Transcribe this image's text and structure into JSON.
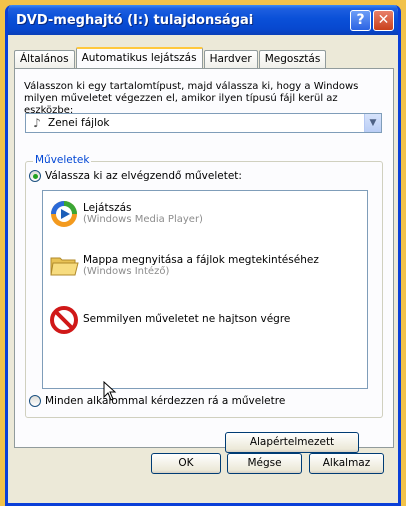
{
  "window": {
    "title": "DVD-meghajtó (I:) tulajdonságai",
    "help_label": "?",
    "close_label": "✕"
  },
  "tabs": [
    {
      "label": "Általános"
    },
    {
      "label": "Automatikus lejátszás"
    },
    {
      "label": "Hardver"
    },
    {
      "label": "Megosztás"
    }
  ],
  "active_tab": "Automatikus lejátszás",
  "content_type": {
    "description": "Válasszon ki egy tartalomtípust, majd válassza ki, hogy a Windows milyen műveletet végezzen el, amikor ilyen típusú fájl kerül az eszközbe:",
    "selected": "Zenei fájlok",
    "icon": "music-file-icon"
  },
  "actions_group": {
    "label": "Műveletek",
    "choose_label": "Válassza ki az elvégzendő műveletet:",
    "ask_label": "Minden alkalommal kérdezzen rá a műveletre",
    "selected_option": "choose",
    "items": [
      {
        "name": "Lejátszás",
        "sub": "(Windows Media Player)",
        "icon": "media-player-icon"
      },
      {
        "name": "Mappa megnyitása a fájlok megtekintéséhez",
        "sub": "(Windows Intéző)",
        "icon": "folder-icon"
      },
      {
        "name": "Semmilyen műveletet ne hajtson végre",
        "sub": "",
        "icon": "no-action-icon"
      }
    ]
  },
  "buttons": {
    "restore_defaults": "Alapértelmezett",
    "ok": "OK",
    "cancel": "Mégse",
    "apply": "Alkalmaz"
  },
  "colors": {
    "title_bar": "#0a50d8",
    "group_label": "#0046d5",
    "background": "#f2c24a"
  }
}
